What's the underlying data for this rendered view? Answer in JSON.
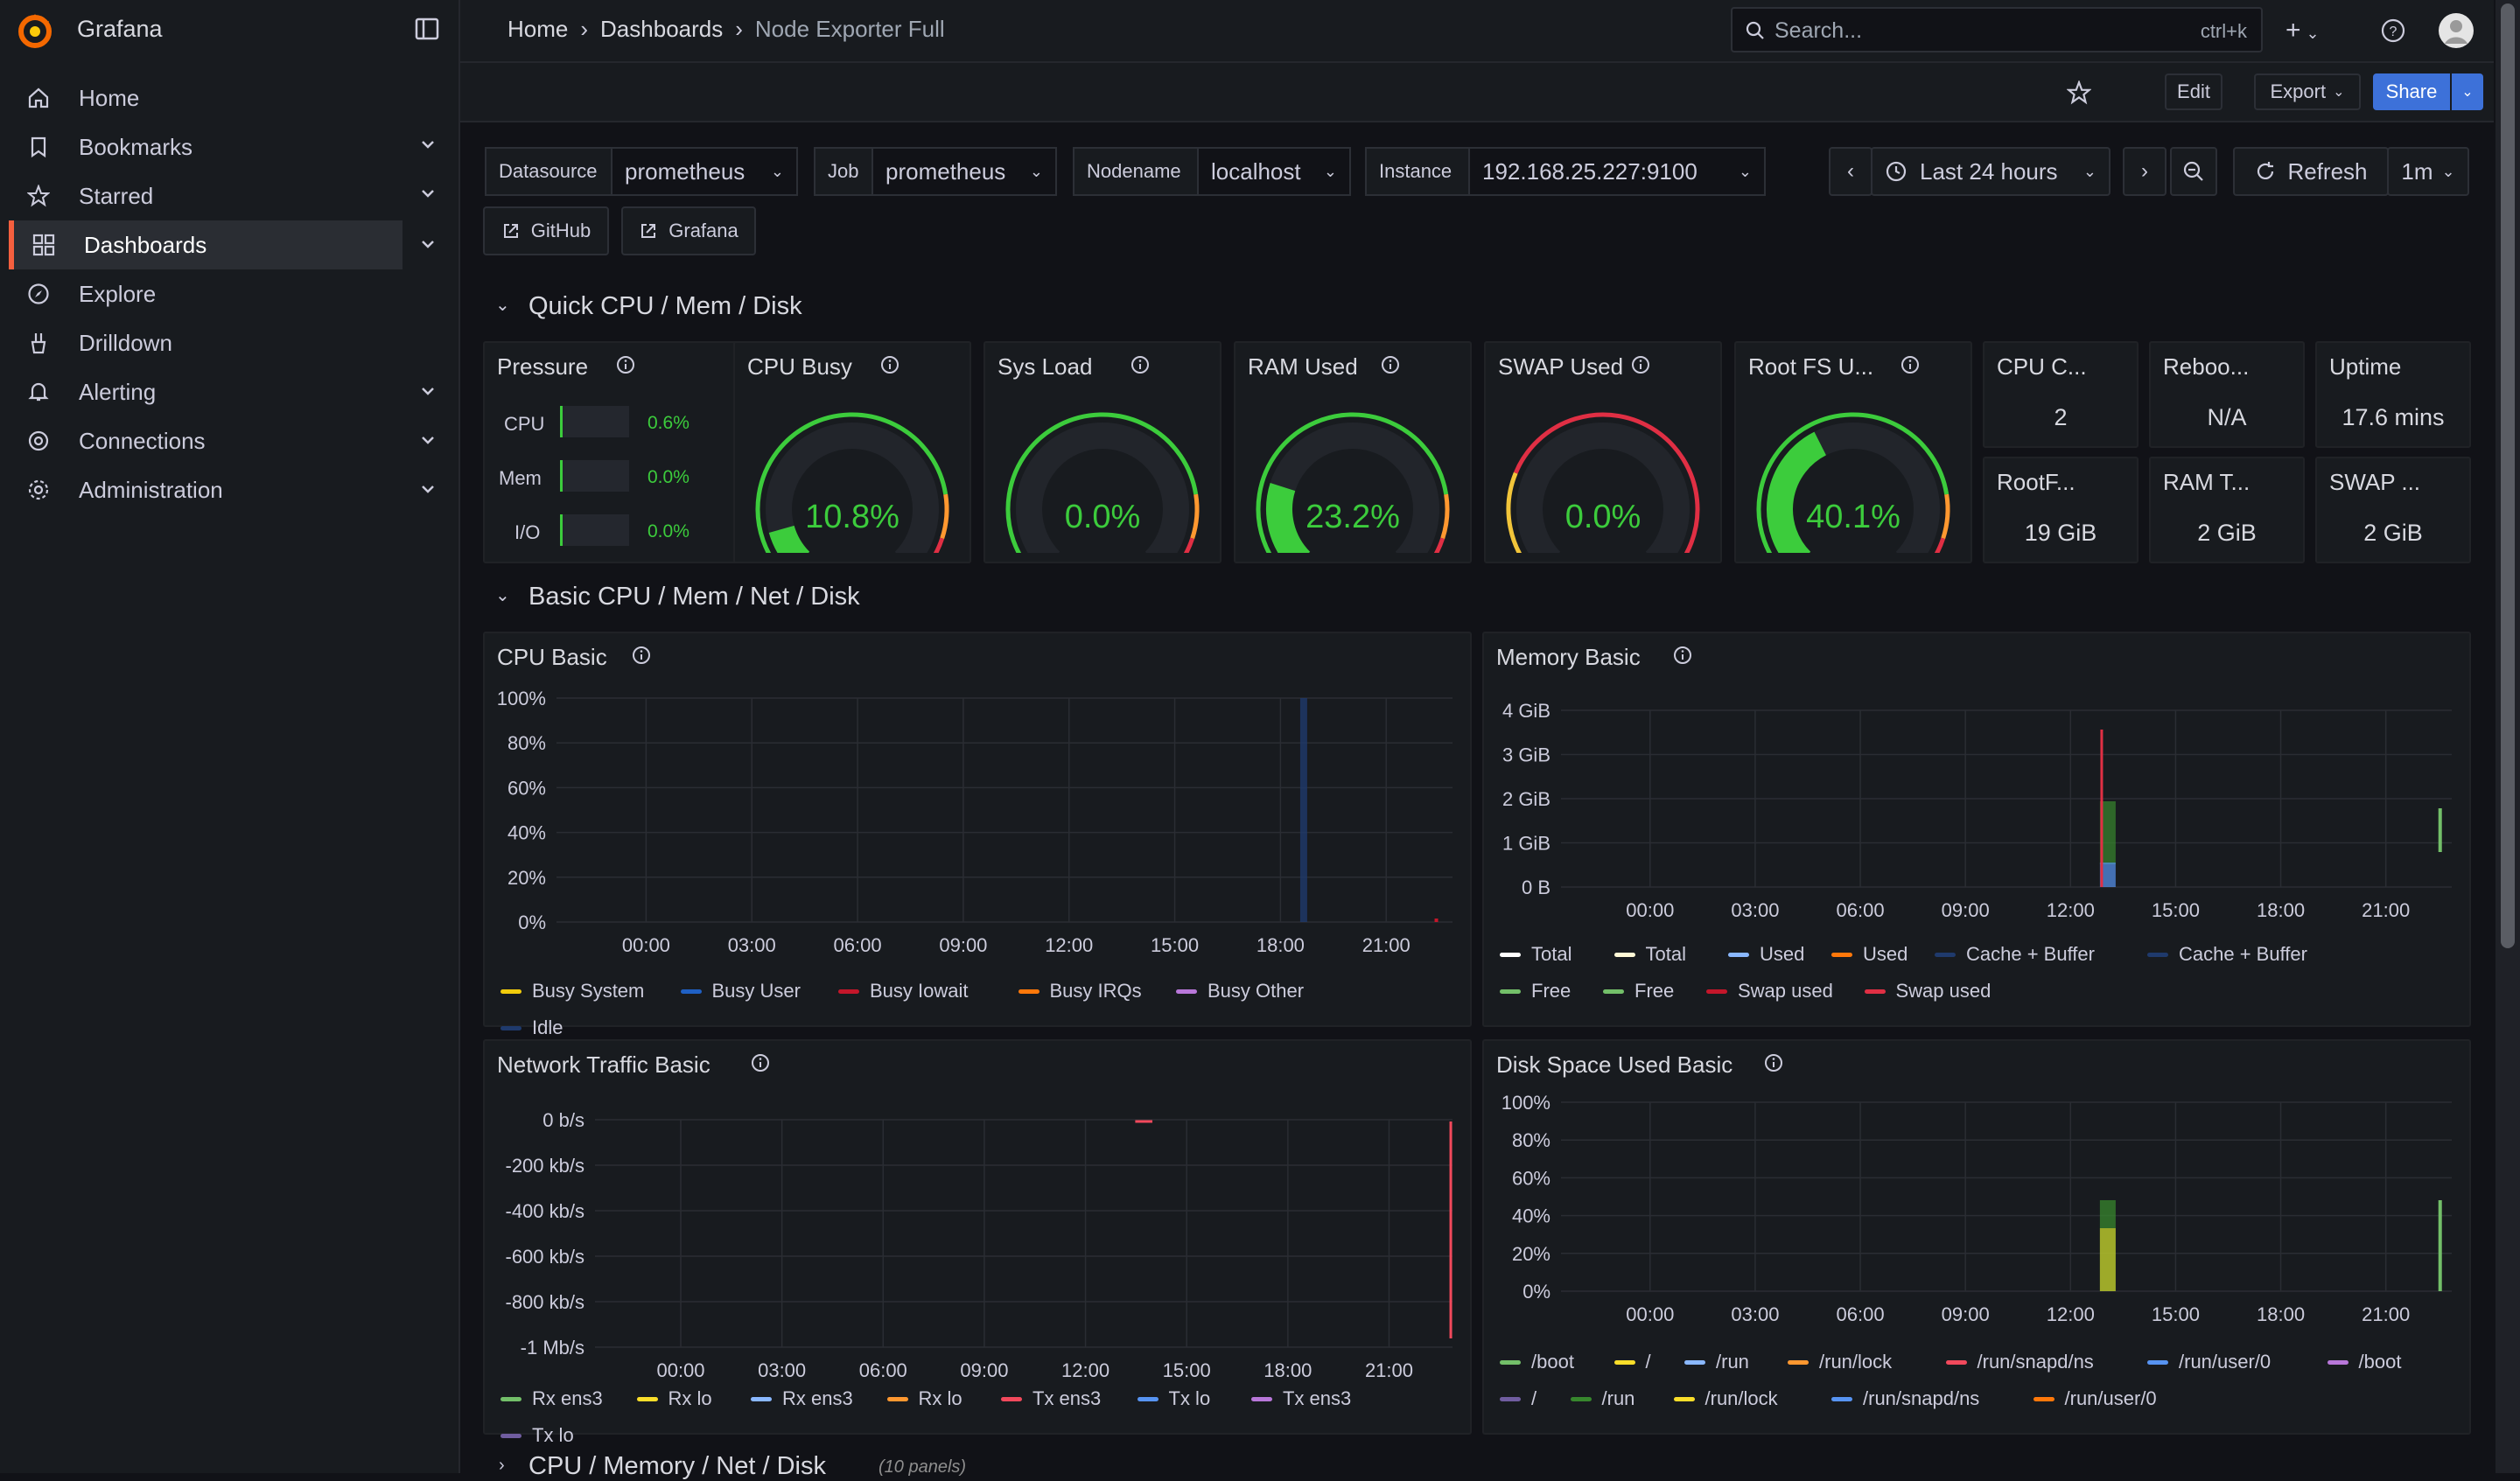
{
  "app": {
    "name": "Grafana"
  },
  "breadcrumb": [
    "Home",
    "Dashboards",
    "Node Exporter Full"
  ],
  "search": {
    "placeholder": "Search...",
    "shortcut": "ctrl+k"
  },
  "toolbar": {
    "edit": "Edit",
    "export": "Export",
    "share": "Share"
  },
  "sidebar": {
    "items": [
      {
        "label": "Home",
        "icon": "home-icon",
        "chevron": false
      },
      {
        "label": "Bookmarks",
        "icon": "bookmark-icon",
        "chevron": true
      },
      {
        "label": "Starred",
        "icon": "star-icon",
        "chevron": true
      },
      {
        "label": "Dashboards",
        "icon": "dashboards-icon",
        "chevron": true,
        "active": true
      },
      {
        "label": "Explore",
        "icon": "compass-icon",
        "chevron": false
      },
      {
        "label": "Drilldown",
        "icon": "drilldown-icon",
        "chevron": false
      },
      {
        "label": "Alerting",
        "icon": "bell-icon",
        "chevron": true
      },
      {
        "label": "Connections",
        "icon": "connections-icon",
        "chevron": true
      },
      {
        "label": "Administration",
        "icon": "gear-icon",
        "chevron": true
      }
    ]
  },
  "variables": {
    "datasource": {
      "label": "Datasource",
      "value": "prometheus"
    },
    "job": {
      "label": "Job",
      "value": "prometheus"
    },
    "nodename": {
      "label": "Nodename",
      "value": "localhost"
    },
    "instance": {
      "label": "Instance",
      "value": "192.168.25.227:9100"
    }
  },
  "timepicker": {
    "range": "Last 24 hours",
    "refresh": "Refresh",
    "interval": "1m"
  },
  "links": {
    "github": "GitHub",
    "grafana": "Grafana"
  },
  "rows": {
    "quick": "Quick CPU / Mem / Disk",
    "basic": "Basic CPU / Mem / Net / Disk",
    "cpu_mem": "CPU / Memory / Net / Disk",
    "cpu_mem_count": "(10 panels)"
  },
  "pressure": {
    "title": "Pressure",
    "rows": [
      {
        "label": "CPU",
        "value": "0.6%"
      },
      {
        "label": "Mem",
        "value": "0.0%"
      },
      {
        "label": "I/O",
        "value": "0.0%"
      }
    ]
  },
  "gauges": [
    {
      "title": "CPU Busy",
      "value": "10.8%",
      "fraction": 0.108
    },
    {
      "title": "Sys Load",
      "value": "0.0%",
      "fraction": 0.0
    },
    {
      "title": "RAM Used",
      "value": "23.2%",
      "fraction": 0.232
    },
    {
      "title": "SWAP Used",
      "value": "0.0%",
      "fraction": 0.0
    },
    {
      "title": "Root FS U...",
      "value": "40.1%",
      "fraction": 0.401
    }
  ],
  "stats": [
    {
      "title": "CPU C...",
      "value": "2"
    },
    {
      "title": "Reboo...",
      "value": "N/A"
    },
    {
      "title": "Uptime",
      "value": "17.6 mins"
    },
    {
      "title": "RootF...",
      "value": "19 GiB"
    },
    {
      "title": "RAM T...",
      "value": "2 GiB"
    },
    {
      "title": "SWAP ...",
      "value": "2 GiB"
    }
  ],
  "colors": {
    "accent": "#f55f3e",
    "green": "#3ccc3c",
    "blue_button": "#3d71d9"
  },
  "panels": {
    "cpu_basic": {
      "title": "CPU Basic",
      "y_ticks": [
        "100%",
        "80%",
        "60%",
        "40%",
        "20%",
        "0%"
      ],
      "x_ticks": [
        "00:00",
        "03:00",
        "06:00",
        "09:00",
        "12:00",
        "15:00",
        "18:00",
        "21:00"
      ],
      "legend": [
        {
          "name": "Busy System",
          "color": "#f2cc0c"
        },
        {
          "name": "Busy User",
          "color": "#1f60c4"
        },
        {
          "name": "Busy Iowait",
          "color": "#c4162a"
        },
        {
          "name": "Busy IRQs",
          "color": "#ff780a"
        },
        {
          "name": "Busy Other",
          "color": "#b877d9"
        },
        {
          "name": "Idle",
          "color": "#1f3a6c"
        }
      ]
    },
    "memory_basic": {
      "title": "Memory Basic",
      "y_ticks": [
        "4 GiB",
        "3 GiB",
        "2 GiB",
        "1 GiB",
        "0 B"
      ],
      "x_ticks": [
        "00:00",
        "03:00",
        "06:00",
        "09:00",
        "12:00",
        "15:00",
        "18:00",
        "21:00"
      ],
      "legend": [
        {
          "name": "Total",
          "color": "#ffffff"
        },
        {
          "name": "Total",
          "color": "#fff9d6"
        },
        {
          "name": "Used",
          "color": "#8ab8ff"
        },
        {
          "name": "Used",
          "color": "#ff780a"
        },
        {
          "name": "Cache + Buffer",
          "color": "#1f3a6c"
        },
        {
          "name": "Cache + Buffer",
          "color": "#1f3a6c"
        },
        {
          "name": "Free",
          "color": "#73bf69"
        },
        {
          "name": "Free",
          "color": "#73bf69"
        },
        {
          "name": "Swap used",
          "color": "#c4162a"
        },
        {
          "name": "Swap used",
          "color": "#e02f44"
        }
      ]
    },
    "network_basic": {
      "title": "Network Traffic Basic",
      "y_ticks": [
        "0 b/s",
        "-200 kb/s",
        "-400 kb/s",
        "-600 kb/s",
        "-800 kb/s",
        "-1 Mb/s"
      ],
      "x_ticks": [
        "00:00",
        "03:00",
        "06:00",
        "09:00",
        "12:00",
        "15:00",
        "18:00",
        "21:00"
      ],
      "legend": [
        {
          "name": "Rx ens3",
          "color": "#73bf69"
        },
        {
          "name": "Rx lo",
          "color": "#fade2a"
        },
        {
          "name": "Rx ens3",
          "color": "#8ab8ff"
        },
        {
          "name": "Rx lo",
          "color": "#ff9830"
        },
        {
          "name": "Tx ens3",
          "color": "#f2495c"
        },
        {
          "name": "Tx lo",
          "color": "#5794f2"
        },
        {
          "name": "Tx ens3",
          "color": "#b877d9"
        },
        {
          "name": "Tx lo",
          "color": "#705da0"
        }
      ]
    },
    "disk_basic": {
      "title": "Disk Space Used Basic",
      "y_ticks": [
        "100%",
        "80%",
        "60%",
        "40%",
        "20%",
        "0%"
      ],
      "x_ticks": [
        "00:00",
        "03:00",
        "06:00",
        "09:00",
        "12:00",
        "15:00",
        "18:00",
        "21:00"
      ],
      "legend": [
        {
          "name": "/boot",
          "color": "#73bf69"
        },
        {
          "name": "/",
          "color": "#fade2a"
        },
        {
          "name": "/run",
          "color": "#8ab8ff"
        },
        {
          "name": "/run/lock",
          "color": "#ff9830"
        },
        {
          "name": "/run/snapd/ns",
          "color": "#f2495c"
        },
        {
          "name": "/run/user/0",
          "color": "#5794f2"
        },
        {
          "name": "/boot",
          "color": "#b877d9"
        },
        {
          "name": "/",
          "color": "#705da0"
        },
        {
          "name": "/run",
          "color": "#37872d"
        },
        {
          "name": "/run/lock",
          "color": "#fade2a"
        },
        {
          "name": "/run/snapd/ns",
          "color": "#5794f2"
        },
        {
          "name": "/run/user/0",
          "color": "#ff780a"
        }
      ]
    }
  }
}
